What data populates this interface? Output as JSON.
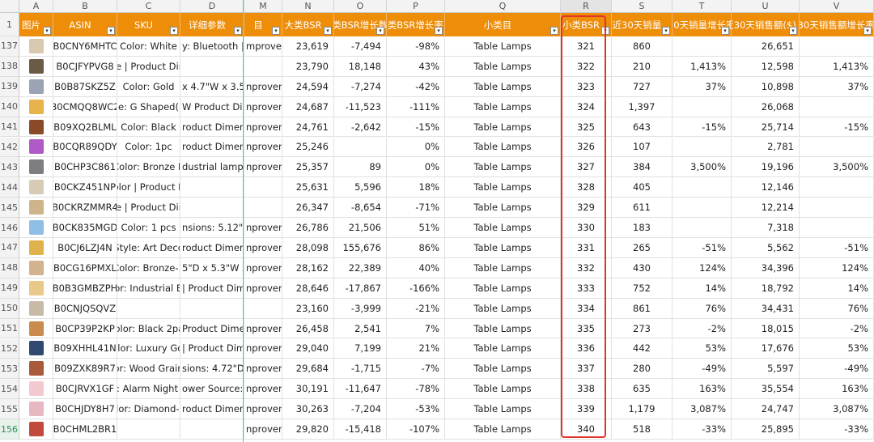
{
  "column_letters": [
    "",
    "A",
    "B",
    "C",
    "D",
    "M",
    "N",
    "O",
    "P",
    "Q",
    "R",
    "S",
    "T",
    "U",
    "V"
  ],
  "headers": [
    "",
    "图片",
    "ASIN",
    "SKU",
    "详细参数",
    "目",
    "大类BSR",
    "大类BSR增长数",
    "大类BSR增长率",
    "小类目",
    "小类BSR",
    "近30天销量",
    "近30天销量增长率",
    "近30天销售额($)",
    "近30天销售额增长率"
  ],
  "filter_icon": "filter-dropdown-icon",
  "highlight_color": "#e0352b",
  "header_color": "#ee8d08",
  "rows": [
    {
      "num": "137",
      "img": "#d9c9b0",
      "asin": "B0CNY6MHTC",
      "sku": "Color: White",
      "param": "y: Bluetooth | Spe",
      "m": "mproveme",
      "n": "23,619",
      "o": "-7,494",
      "p": "-98%",
      "q": "Table Lamps",
      "r": "321",
      "s": "860",
      "t": "",
      "u": "26,651",
      "v": ""
    },
    {
      "num": "138",
      "img": "#6b5a46",
      "asin": "B0CJFYPVG8",
      "sku": "olor: White | Product Dimensions:",
      "param": "",
      "m": "",
      "n": "23,790",
      "o": "18,148",
      "p": "43%",
      "q": "Table Lamps",
      "r": "322",
      "s": "210",
      "t": "1,413%",
      "u": "12,598",
      "v": "1,413%"
    },
    {
      "num": "139",
      "img": "#9aa4b4",
      "asin": "B0B87SKZ5Z",
      "sku": "Color: Gold",
      "param": "x 4.7\"W x 3.5\"H |",
      "m": "nproveme",
      "n": "24,594",
      "o": "-7,274",
      "p": "-42%",
      "q": "Table Lamps",
      "r": "323",
      "s": "727",
      "t": "37%",
      "u": "10,898",
      "v": "37%"
    },
    {
      "num": "140",
      "img": "#e8b34a",
      "asin": "B0CMQQ8WC2",
      "sku": "e: G Shaped(",
      "param": "W Product Dimensio",
      "m": "nproveme",
      "n": "24,687",
      "o": "-11,523",
      "p": "-111%",
      "q": "Table Lamps",
      "r": "324",
      "s": "1,397",
      "t": "",
      "u": "26,068",
      "v": ""
    },
    {
      "num": "141",
      "img": "#8a4a2a",
      "asin": "B09XQ2BLML",
      "sku": "Color: Black",
      "param": "roduct Dimension",
      "m": "nproveme",
      "n": "24,761",
      "o": "-2,642",
      "p": "-15%",
      "q": "Table Lamps",
      "r": "325",
      "s": "643",
      "t": "-15%",
      "u": "25,714",
      "v": "-15%"
    },
    {
      "num": "142",
      "img": "#b05ac8",
      "asin": "B0CQR89QDY",
      "sku": "Color: 1pc",
      "param": "roduct Dimension",
      "m": "nproveme",
      "n": "25,246",
      "o": "",
      "p": "0%",
      "q": "Table Lamps",
      "r": "326",
      "s": "107",
      "t": "",
      "u": "2,781",
      "v": ""
    },
    {
      "num": "143",
      "img": "#7d7d82",
      "asin": "B0CHP3C861",
      "sku": "Color: Bronze B",
      "param": "dustrial lamp rob",
      "m": "nproveme",
      "n": "25,357",
      "o": "89",
      "p": "0%",
      "q": "Table Lamps",
      "r": "327",
      "s": "384",
      "t": "3,500%",
      "u": "19,196",
      "v": "3,500%"
    },
    {
      "num": "144",
      "img": "#d8cbb6",
      "asin": "B0CKZ451NP",
      "sku": "olor: Multicolor | Product Dimensions:",
      "param": "",
      "m": "",
      "n": "25,631",
      "o": "5,596",
      "p": "18%",
      "q": "Table Lamps",
      "r": "328",
      "s": "405",
      "t": "",
      "u": "12,146",
      "v": ""
    },
    {
      "num": "145",
      "img": "#cdb48a",
      "asin": "B0CKRZMMR4",
      "sku": "olor: White | Product Dimensions:",
      "param": "",
      "m": "",
      "n": "26,347",
      "o": "-8,654",
      "p": "-71%",
      "q": "Table Lamps",
      "r": "329",
      "s": "611",
      "t": "",
      "u": "12,214",
      "v": ""
    },
    {
      "num": "146",
      "img": "#8fbfe6",
      "asin": "B0CK835MGD",
      "sku": "Color: 1 pcs",
      "param": "nsions: 5.12\"D x",
      "m": "nproveme",
      "n": "26,786",
      "o": "21,506",
      "p": "51%",
      "q": "Table Lamps",
      "r": "330",
      "s": "183",
      "t": "",
      "u": "7,318",
      "v": ""
    },
    {
      "num": "147",
      "img": "#e0b24c",
      "asin": "B0CJ6LZJ4N",
      "sku": "Style: Art Deco",
      "param": "roduct Dimension",
      "m": "nproveme",
      "n": "28,098",
      "o": "155,676",
      "p": "86%",
      "q": "Table Lamps",
      "r": "331",
      "s": "265",
      "t": "-51%",
      "u": "5,562",
      "v": "-51%"
    },
    {
      "num": "148",
      "img": "#d2b38e",
      "asin": "B0CG16PMXL",
      "sku": "Color: Bronze-1",
      "param": "5\"D x 5.3\"W x 26",
      "m": "nproveme",
      "n": "28,162",
      "o": "22,389",
      "p": "40%",
      "q": "Table Lamps",
      "r": "332",
      "s": "430",
      "t": "124%",
      "u": "34,396",
      "v": "124%"
    },
    {
      "num": "149",
      "img": "#e9c98a",
      "asin": "B0B3GMBZPH",
      "sku": "olor: Industrial Bla",
      "param": "| Product Dimens",
      "m": "nproveme",
      "n": "28,646",
      "o": "-17,867",
      "p": "-166%",
      "q": "Table Lamps",
      "r": "333",
      "s": "752",
      "t": "14%",
      "u": "18,792",
      "v": "14%"
    },
    {
      "num": "150",
      "img": "#c7bba8",
      "asin": "B0CNJQSQVZ",
      "sku": "",
      "param": "",
      "m": "",
      "n": "23,160",
      "o": "-3,999",
      "p": "-21%",
      "q": "Table Lamps",
      "r": "334",
      "s": "861",
      "t": "76%",
      "u": "34,431",
      "v": "76%"
    },
    {
      "num": "151",
      "img": "#c98b4e",
      "asin": "B0CP39P2KP",
      "sku": "Color: Black 2pac",
      "param": "Product Dimensio",
      "m": "nproveme",
      "n": "26,458",
      "o": "2,541",
      "p": "7%",
      "q": "Table Lamps",
      "r": "335",
      "s": "273",
      "t": "-2%",
      "u": "18,015",
      "v": "-2%"
    },
    {
      "num": "152",
      "img": "#2f4a6e",
      "asin": "B09XHHL41N",
      "sku": "Color: Luxury Gold",
      "param": "| Product Dime",
      "m": "nproveme",
      "n": "29,040",
      "o": "7,199",
      "p": "21%",
      "q": "Table Lamps",
      "r": "336",
      "s": "442",
      "t": "53%",
      "u": "17,676",
      "v": "53%"
    },
    {
      "num": "153",
      "img": "#a85a3a",
      "asin": "B09ZXK89R7",
      "sku": "or: Wood Grain",
      "param": "sions: 4.72\"D x 9.",
      "m": "nproveme",
      "n": "29,684",
      "o": "-1,715",
      "p": "-7%",
      "q": "Table Lamps",
      "r": "337",
      "s": "280",
      "t": "-49%",
      "u": "5,597",
      "v": "-49%"
    },
    {
      "num": "154",
      "img": "#f2c9cf",
      "asin": "B0CJRVX1GF",
      "sku": "e: Alarm Night L",
      "param": "ower Source: Batt",
      "m": "nproveme",
      "n": "30,191",
      "o": "-11,647",
      "p": "-78%",
      "q": "Table Lamps",
      "r": "338",
      "s": "635",
      "t": "163%",
      "u": "35,554",
      "v": "163%"
    },
    {
      "num": "155",
      "img": "#e6b8c2",
      "asin": "B0CHJDY8H7",
      "sku": "olor: Diamond-G",
      "param": "roduct Dimension",
      "m": "nproveme",
      "n": "30,263",
      "o": "-7,204",
      "p": "-53%",
      "q": "Table Lamps",
      "r": "339",
      "s": "1,179",
      "t": "3,087%",
      "u": "24,747",
      "v": "3,087%"
    },
    {
      "num": "156",
      "img": "#c24a3a",
      "asin": "B0CHML2BR1",
      "sku": "",
      "param": "",
      "m": "nproveme",
      "n": "29,820",
      "o": "-15,418",
      "p": "-107%",
      "q": "Table Lamps",
      "r": "340",
      "s": "518",
      "t": "-33%",
      "u": "25,895",
      "v": "-33%"
    }
  ]
}
